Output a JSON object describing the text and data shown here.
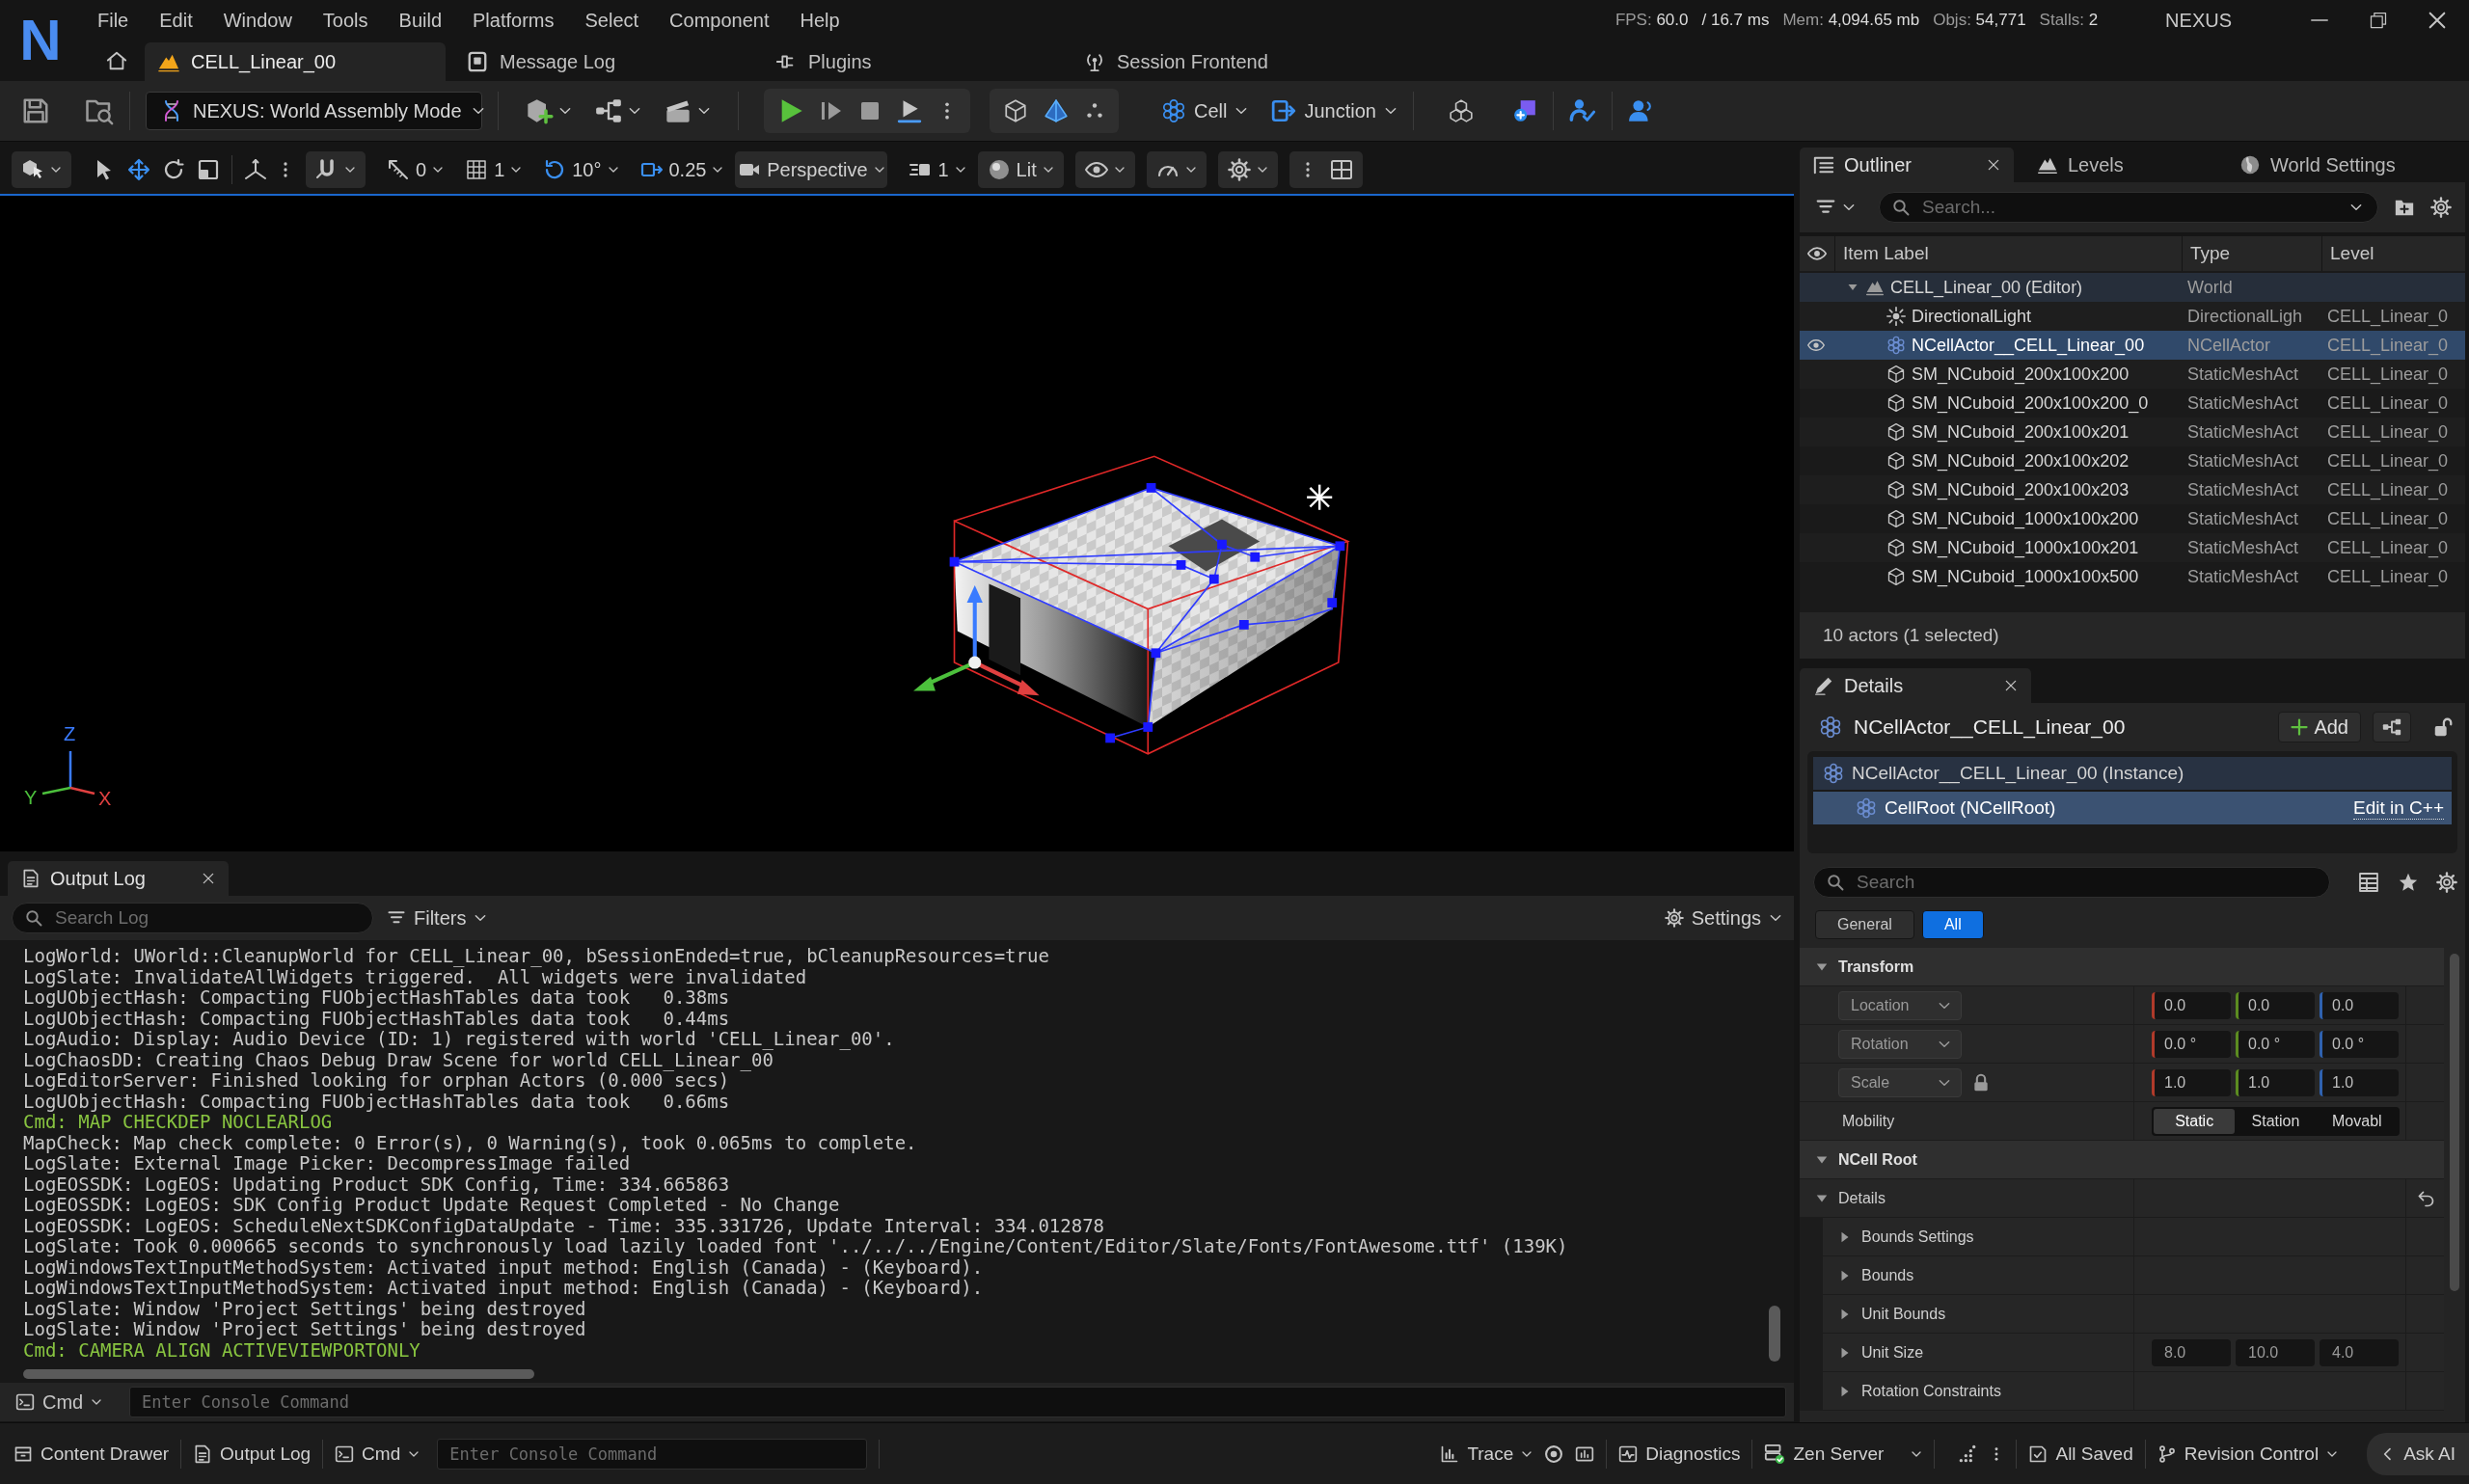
{
  "title_bar": {
    "logo": "N",
    "menu": [
      "File",
      "Edit",
      "Window",
      "Tools",
      "Build",
      "Platforms",
      "Select",
      "Component",
      "Help"
    ],
    "stats": [
      {
        "label": "FPS:",
        "value": "60.0"
      },
      {
        "value": "/ 16.7 ms"
      },
      {
        "label": "Mem:",
        "value": "4,094.65 mb"
      },
      {
        "label": "Objs:",
        "value": "54,771"
      },
      {
        "label": "Stalls:",
        "value": "2"
      }
    ],
    "app_name": "NEXUS"
  },
  "document_tabs": [
    {
      "label": "CELL_Linear_00",
      "selected": true
    },
    {
      "label": "Message Log",
      "selected": false
    },
    {
      "label": "Plugins",
      "selected": false
    },
    {
      "label": "Session Frontend",
      "selected": false
    }
  ],
  "main_toolbar": {
    "mode": "NEXUS: World Assembly Mode",
    "tool_menus": [
      "Cell",
      "Junction"
    ]
  },
  "viewport_toolbar": {
    "transform_tools": [
      {
        "kind": "select",
        "selected": false
      },
      {
        "kind": "translate",
        "selected": true
      },
      {
        "kind": "rotate",
        "selected": false
      },
      {
        "kind": "scale",
        "selected": false
      }
    ],
    "snaps": [
      {
        "kind": "surface",
        "value": "0",
        "on": false
      },
      {
        "kind": "grid",
        "value": "1",
        "on": false
      },
      {
        "kind": "rotation",
        "value": "10°",
        "on": true
      },
      {
        "kind": "scale",
        "value": "0.25",
        "on": true
      }
    ],
    "view_mode": "Perspective",
    "camera_speed": "1",
    "lighting": "Lit"
  },
  "viewport": {
    "axis_labels": [
      {
        "kind": "z",
        "label": "Z"
      },
      {
        "kind": "y",
        "label": "Y"
      },
      {
        "kind": "x",
        "label": "X"
      }
    ]
  },
  "output_log": {
    "tab": "Output Log",
    "search_placeholder": "Search Log",
    "filters": "Filters",
    "settings": "Settings",
    "lines": [
      {
        "kind": "log",
        "text": "LogWorld: UWorld::CleanupWorld for CELL_Linear_00, bSessionEnded=true, bCleanupResources=true"
      },
      {
        "kind": "log",
        "text": "LogSlate: InvalidateAllWidgets triggered.  All widgets were invalidated"
      },
      {
        "kind": "log",
        "text": "LogUObjectHash: Compacting FUObjectHashTables data took   0.38ms"
      },
      {
        "kind": "log",
        "text": "LogUObjectHash: Compacting FUObjectHashTables data took   0.44ms"
      },
      {
        "kind": "log",
        "text": "LogAudio: Display: Audio Device (ID: 1) registered with world 'CELL_Linear_00'."
      },
      {
        "kind": "log",
        "text": "LogChaosDD: Creating Chaos Debug Draw Scene for world CELL_Linear_00"
      },
      {
        "kind": "log",
        "text": "LogEditorServer: Finished looking for orphan Actors (0.000 secs)"
      },
      {
        "kind": "log",
        "text": "LogUObjectHash: Compacting FUObjectHashTables data took   0.66ms"
      },
      {
        "kind": "command",
        "text": "Cmd: MAP CHECKDEP NOCLEARLOG"
      },
      {
        "kind": "log",
        "text": "MapCheck: Map check complete: 0 Error(s), 0 Warning(s), took 0.065ms to complete."
      },
      {
        "kind": "log",
        "text": "LogSlate: External Image Picker: DecompressImage failed"
      },
      {
        "kind": "log",
        "text": "LogEOSSDK: LogEOS: Updating Product SDK Config, Time: 334.665863"
      },
      {
        "kind": "log",
        "text": "LogEOSSDK: LogEOS: SDK Config Product Update Request Completed - No Change"
      },
      {
        "kind": "log",
        "text": "LogEOSSDK: LogEOS: ScheduleNextSDKConfigDataUpdate - Time: 335.331726, Update Interval: 334.012878"
      },
      {
        "kind": "log",
        "text": "LogSlate: Took 0.000665 seconds to synchronously load lazily loaded font '../../../Engine/Content/Editor/Slate/Fonts/FontAwesome.ttf' (139K)"
      },
      {
        "kind": "log",
        "text": "LogWindowsTextInputMethodSystem: Activated input method: English (Canada) - (Keyboard)."
      },
      {
        "kind": "log",
        "text": "LogWindowsTextInputMethodSystem: Activated input method: English (Canada) - (Keyboard)."
      },
      {
        "kind": "log",
        "text": "LogSlate: Window 'Project Settings' being destroyed"
      },
      {
        "kind": "log",
        "text": "LogSlate: Window 'Project Settings' being destroyed"
      },
      {
        "kind": "command",
        "text": "Cmd: CAMERA ALIGN ACTIVEVIEWPORTONLY"
      }
    ],
    "console": {
      "mode": "Cmd",
      "placeholder": "Enter Console Command"
    }
  },
  "outliner": {
    "tabs": [
      {
        "label": "Outliner",
        "selected": true
      },
      {
        "label": "Levels",
        "selected": false
      },
      {
        "label": "World Settings",
        "selected": false
      }
    ],
    "search_placeholder": "Search...",
    "columns": [
      "Item Label",
      "Type",
      "Level"
    ],
    "tree": [
      {
        "kind": "world",
        "label": "CELL_Linear_00 (Editor)",
        "type": "World",
        "selected": false,
        "expanded": true,
        "children": [
          {
            "kind": "light",
            "label": "DirectionalLight",
            "type": "DirectionalLigh",
            "level": "CELL_Linear_0",
            "selected": false
          },
          {
            "kind": "actor",
            "label": "NCellActor__CELL_Linear_00",
            "type": "NCellActor",
            "level": "CELL_Linear_0",
            "selected": true
          },
          {
            "kind": "mesh",
            "label": "SM_NCuboid_200x100x200",
            "type": "StaticMeshAct",
            "level": "CELL_Linear_0",
            "selected": false
          },
          {
            "kind": "mesh",
            "label": "SM_NCuboid_200x100x200_0",
            "type": "StaticMeshAct",
            "level": "CELL_Linear_0",
            "selected": false
          },
          {
            "kind": "mesh",
            "label": "SM_NCuboid_200x100x201",
            "type": "StaticMeshAct",
            "level": "CELL_Linear_0",
            "selected": false
          },
          {
            "kind": "mesh",
            "label": "SM_NCuboid_200x100x202",
            "type": "StaticMeshAct",
            "level": "CELL_Linear_0",
            "selected": false
          },
          {
            "kind": "mesh",
            "label": "SM_NCuboid_200x100x203",
            "type": "StaticMeshAct",
            "level": "CELL_Linear_0",
            "selected": false
          },
          {
            "kind": "mesh",
            "label": "SM_NCuboid_1000x100x200",
            "type": "StaticMeshAct",
            "level": "CELL_Linear_0",
            "selected": false
          },
          {
            "kind": "mesh",
            "label": "SM_NCuboid_1000x100x201",
            "type": "StaticMeshAct",
            "level": "CELL_Linear_0",
            "selected": false
          },
          {
            "kind": "mesh",
            "label": "SM_NCuboid_1000x100x500",
            "type": "StaticMeshAct",
            "level": "CELL_Linear_0",
            "selected": false
          }
        ]
      }
    ],
    "footer": "10 actors (1 selected)"
  },
  "details": {
    "tab": "Details",
    "actor": "NCellActor__CELL_Linear_00",
    "add_button": "Add",
    "components": [
      {
        "label": "NCellActor__CELL_Linear_00 (Instance)",
        "selected": false,
        "children": [
          {
            "label": "CellRoot (NCellRoot)",
            "selected": true,
            "link": "Edit in C++"
          }
        ]
      }
    ],
    "search_placeholder": "Search",
    "filters": [
      {
        "label": "General",
        "selected": false
      },
      {
        "label": "All",
        "selected": true
      }
    ],
    "sections": [
      {
        "title": "Transform",
        "expanded": true,
        "rows": [
          {
            "kind": "vector",
            "label": "Location",
            "values": [
              "0.0",
              "0.0",
              "0.0"
            ]
          },
          {
            "kind": "vector",
            "label": "Rotation",
            "values": [
              "0.0 °",
              "0.0 °",
              "0.0 °"
            ]
          },
          {
            "kind": "vector",
            "label": "Scale",
            "values": [
              "1.0",
              "1.0",
              "1.0"
            ],
            "locked": true
          },
          {
            "kind": "segmented",
            "label": "Mobility",
            "options": [
              {
                "label": "Static",
                "selected": true
              },
              {
                "label": "Station",
                "selected": false
              },
              {
                "label": "Movabl",
                "selected": false
              }
            ]
          }
        ]
      },
      {
        "title": "NCell Root",
        "expanded": true,
        "rows": [
          {
            "kind": "group",
            "label": "Details",
            "expanded": true,
            "reset": true,
            "children": [
              {
                "kind": "group",
                "label": "Bounds Settings",
                "expanded": false
              },
              {
                "kind": "group",
                "label": "Bounds",
                "expanded": false
              },
              {
                "kind": "group",
                "label": "Unit Bounds",
                "expanded": false
              },
              {
                "kind": "group",
                "label": "Unit Size",
                "expanded": false,
                "values": [
                  "8.0",
                  "10.0",
                  "4.0"
                ]
              },
              {
                "kind": "group",
                "label": "Rotation Constraints",
                "expanded": false
              }
            ]
          }
        ]
      }
    ]
  },
  "status_bar": {
    "buttons": [
      "Content Drawer",
      "Output Log"
    ],
    "console": {
      "mode": "Cmd",
      "placeholder": "Enter Console Command"
    },
    "trace": "Trace",
    "diagnostics": "Diagnostics",
    "zen_server": "Zen Server",
    "save_status": "All Saved",
    "revision_control": "Revision Control",
    "ask_ai": "Ask AI"
  }
}
